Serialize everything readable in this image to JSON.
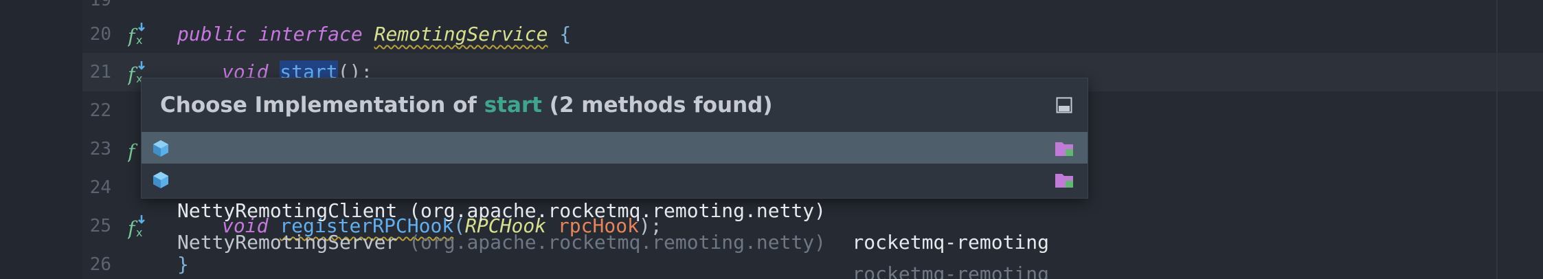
{
  "editor": {
    "lines": [
      {
        "num": "20",
        "has_icon": true
      },
      {
        "num": "21",
        "has_icon": true
      },
      {
        "num": "22",
        "has_icon": false
      },
      {
        "num": "23",
        "has_icon": true
      },
      {
        "num": "24",
        "has_icon": false
      },
      {
        "num": "25",
        "has_icon": true
      },
      {
        "num": "26",
        "has_icon": false
      }
    ],
    "code": {
      "line20": {
        "kw1": "public",
        "kw2": "interface",
        "cls": "RemotingService",
        "brace": "{"
      },
      "line21": {
        "kw": "void",
        "fn": "start",
        "rest": "();"
      },
      "line25": {
        "kw": "void",
        "fn": "registerRPCHook",
        "open": "(",
        "type": "RPCHook",
        "param": "rpcHook",
        "close": ");"
      },
      "line26": {
        "brace": "}"
      }
    }
  },
  "popup": {
    "title_prefix": "Choose Implementation of ",
    "method": "start",
    "title_suffix": " (2 methods found)",
    "pin_icon": "pin-window-icon",
    "items": [
      {
        "name": "NettyRemotingClient",
        "pkg": " (org.apache.rocketmq.remoting.netty)",
        "module": "rocketmq-remoting",
        "selected": true
      },
      {
        "name": "NettyRemotingServer",
        "pkg": " (org.apache.rocketmq.remoting.netty)",
        "module": "rocketmq-remoting",
        "selected": false
      }
    ]
  },
  "colors": {
    "background": "#262b33",
    "selection": "#4f5e6b",
    "method_accent": "#3fa68e",
    "class_icon": "#5ab0e8",
    "module_folder": "#c27ad8"
  }
}
